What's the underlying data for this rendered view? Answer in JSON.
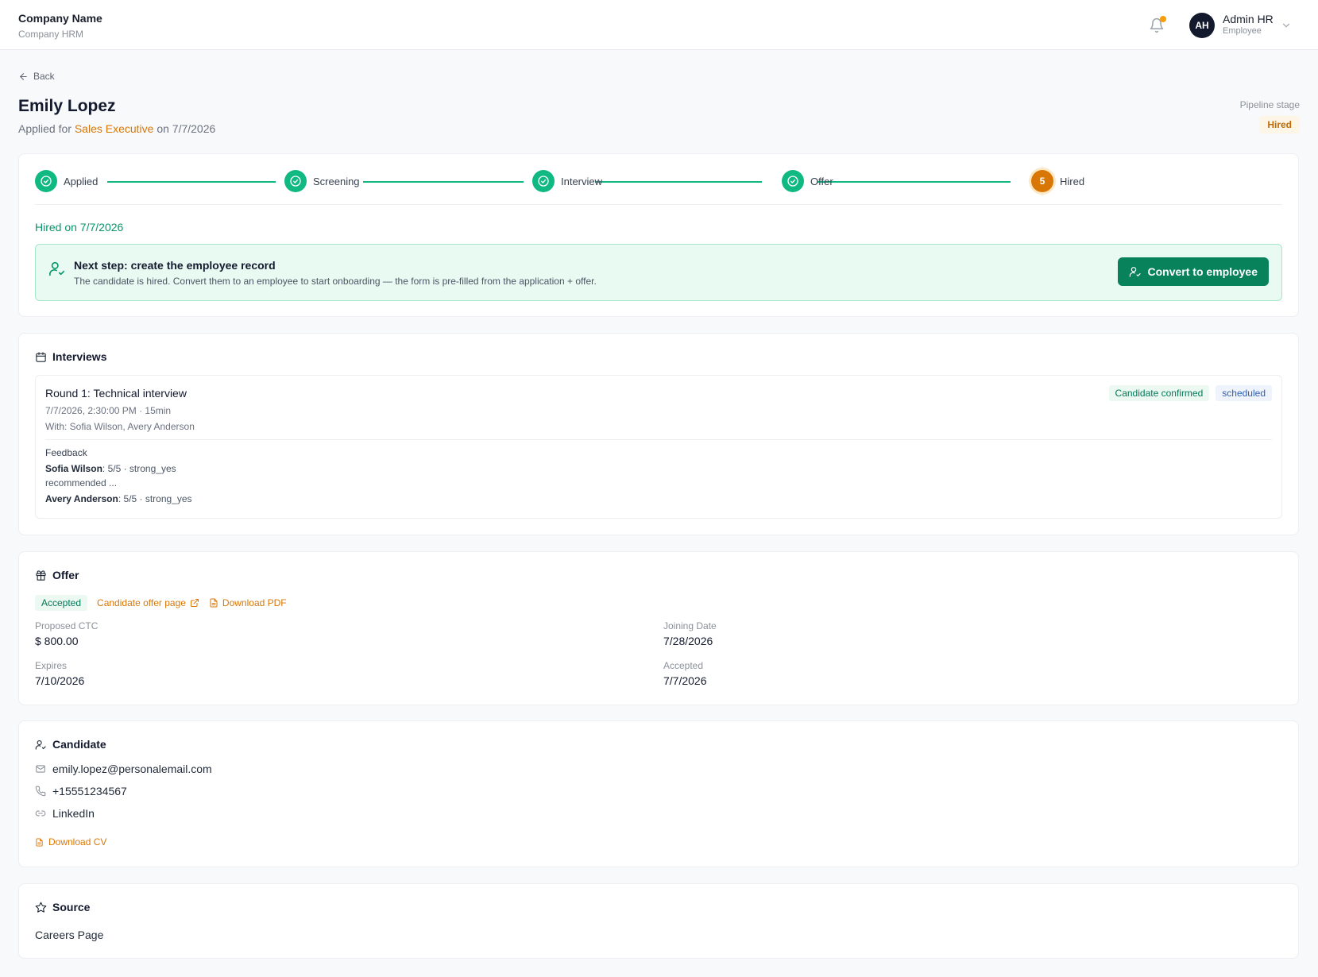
{
  "header": {
    "company_name": "Company Name",
    "company_sub": "Company HRM",
    "user_initials": "AH",
    "user_name": "Admin HR",
    "user_role": "Employee"
  },
  "page": {
    "back_label": "Back",
    "candidate_name": "Emily Lopez",
    "applied_prefix": "Applied for",
    "applied_role": "Sales Executive",
    "applied_suffix": "on 7/7/2026",
    "pipeline_stage_label": "Pipeline stage",
    "pipeline_stage_value": "Hired"
  },
  "pipeline": {
    "steps": [
      {
        "label": "Applied",
        "status": "done"
      },
      {
        "label": "Screening",
        "status": "done"
      },
      {
        "label": "Interview",
        "status": "done"
      },
      {
        "label": "Offer",
        "status": "done"
      },
      {
        "label": "Hired",
        "status": "current",
        "number": "5"
      }
    ],
    "hired_on": "Hired on 7/7/2026",
    "next_step_title": "Next step: create the employee record",
    "next_step_desc": "The candidate is hired. Convert them to an employee to start onboarding — the form is pre-filled from the application + offer.",
    "convert_label": "Convert to employee"
  },
  "interviews": {
    "heading": "Interviews",
    "items": [
      {
        "title": "Round 1: Technical interview",
        "meta": "7/7/2026, 2:30:00 PM · 15min",
        "with": "With: Sofia Wilson, Avery Anderson",
        "badge_confirmed": "Candidate confirmed",
        "badge_status": "scheduled",
        "feedback_label": "Feedback",
        "feedback": [
          {
            "name": "Sofia Wilson",
            "score": ": 5/5 · strong_yes",
            "note": "recommended ..."
          },
          {
            "name": "Avery Anderson",
            "score": ": 5/5 · strong_yes"
          }
        ]
      }
    ]
  },
  "offer": {
    "heading": "Offer",
    "status": "Accepted",
    "offer_page_label": "Candidate offer page",
    "download_pdf_label": "Download PDF",
    "proposed_ctc_label": "Proposed CTC",
    "proposed_ctc_value": "$ 800.00",
    "joining_date_label": "Joining Date",
    "joining_date_value": "7/28/2026",
    "expires_label": "Expires",
    "expires_value": "7/10/2026",
    "accepted_label": "Accepted",
    "accepted_value": "7/7/2026"
  },
  "candidate": {
    "heading": "Candidate",
    "email": "emily.lopez@personalemail.com",
    "phone": "+15551234567",
    "linkedin": "LinkedIn",
    "download_cv_label": "Download CV"
  },
  "source": {
    "heading": "Source",
    "value": "Careers Page"
  },
  "colors": {
    "accent_green": "#07825a",
    "success": "#10b981",
    "warning": "#d97706",
    "dark": "#141a2e"
  },
  "icons": {
    "back": "arrow-left-icon",
    "bell": "bell-icon",
    "user_check": "user-check-icon",
    "calendar": "calendar-icon",
    "gift": "gift-icon",
    "external": "external-link-icon",
    "file": "file-icon",
    "mail": "mail-icon",
    "phone": "phone-icon",
    "link": "link-icon",
    "star": "star-icon",
    "chevron": "chevron-down-icon"
  }
}
